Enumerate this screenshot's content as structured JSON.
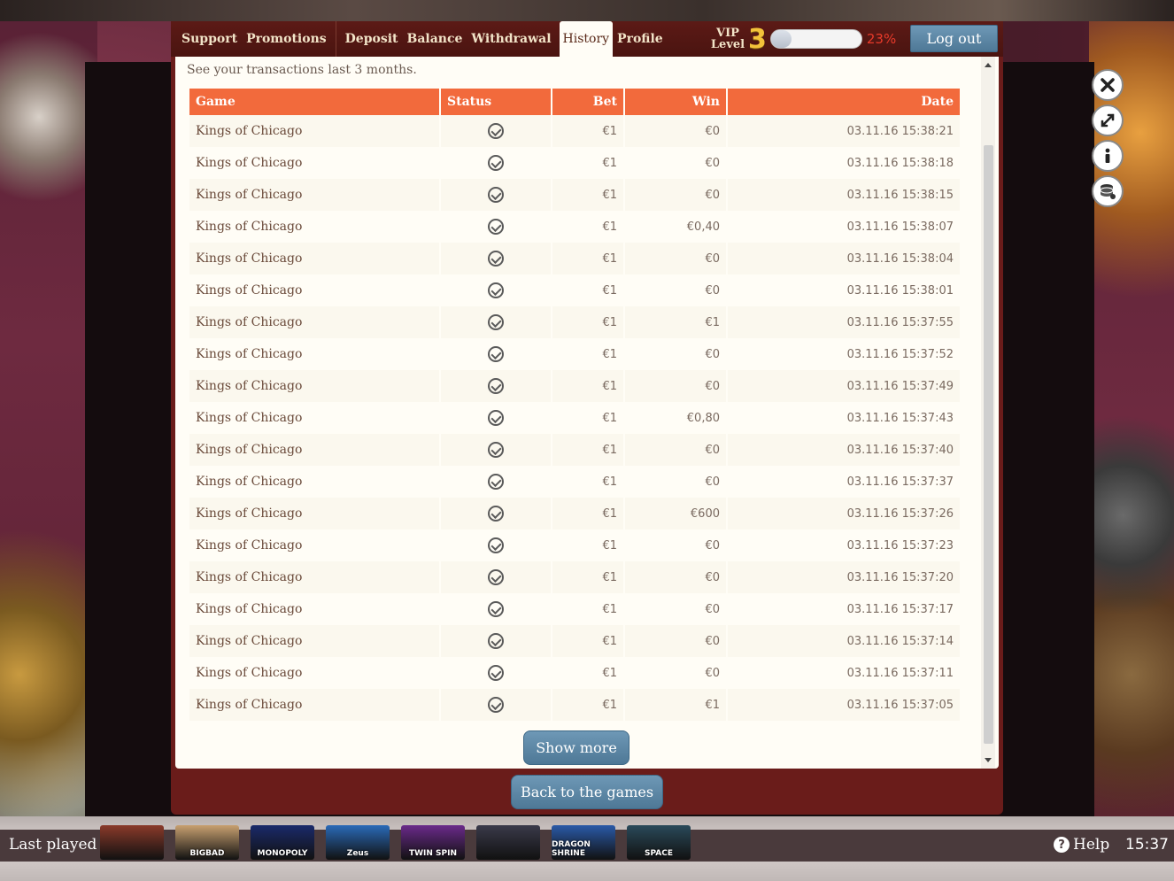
{
  "nav": {
    "support": "Support",
    "promotions": "Promotions",
    "deposit": "Deposit",
    "balance": "Balance",
    "withdrawal": "Withdrawal",
    "history": "History",
    "profile": "Profile"
  },
  "vip": {
    "label_line1": "VIP",
    "label_line2": "Level",
    "level": "3",
    "progress_fraction": 0.23,
    "percent_text": "23%"
  },
  "logout_label": "Log out",
  "intro_text": "See your transactions last 3 months.",
  "table": {
    "headers": {
      "game": "Game",
      "status": "Status",
      "bet": "Bet",
      "win": "Win",
      "date": "Date"
    },
    "rows": [
      {
        "game": "Kings of Chicago",
        "bet": "€1",
        "win": "€0",
        "date": "03.11.16 15:38:21"
      },
      {
        "game": "Kings of Chicago",
        "bet": "€1",
        "win": "€0",
        "date": "03.11.16 15:38:18"
      },
      {
        "game": "Kings of Chicago",
        "bet": "€1",
        "win": "€0",
        "date": "03.11.16 15:38:15"
      },
      {
        "game": "Kings of Chicago",
        "bet": "€1",
        "win": "€0,40",
        "date": "03.11.16 15:38:07"
      },
      {
        "game": "Kings of Chicago",
        "bet": "€1",
        "win": "€0",
        "date": "03.11.16 15:38:04"
      },
      {
        "game": "Kings of Chicago",
        "bet": "€1",
        "win": "€0",
        "date": "03.11.16 15:38:01"
      },
      {
        "game": "Kings of Chicago",
        "bet": "€1",
        "win": "€1",
        "date": "03.11.16 15:37:55"
      },
      {
        "game": "Kings of Chicago",
        "bet": "€1",
        "win": "€0",
        "date": "03.11.16 15:37:52"
      },
      {
        "game": "Kings of Chicago",
        "bet": "€1",
        "win": "€0",
        "date": "03.11.16 15:37:49"
      },
      {
        "game": "Kings of Chicago",
        "bet": "€1",
        "win": "€0,80",
        "date": "03.11.16 15:37:43"
      },
      {
        "game": "Kings of Chicago",
        "bet": "€1",
        "win": "€0",
        "date": "03.11.16 15:37:40"
      },
      {
        "game": "Kings of Chicago",
        "bet": "€1",
        "win": "€0",
        "date": "03.11.16 15:37:37"
      },
      {
        "game": "Kings of Chicago",
        "bet": "€1",
        "win": "€600",
        "date": "03.11.16 15:37:26"
      },
      {
        "game": "Kings of Chicago",
        "bet": "€1",
        "win": "€0",
        "date": "03.11.16 15:37:23"
      },
      {
        "game": "Kings of Chicago",
        "bet": "€1",
        "win": "€0",
        "date": "03.11.16 15:37:20"
      },
      {
        "game": "Kings of Chicago",
        "bet": "€1",
        "win": "€0",
        "date": "03.11.16 15:37:17"
      },
      {
        "game": "Kings of Chicago",
        "bet": "€1",
        "win": "€0",
        "date": "03.11.16 15:37:14"
      },
      {
        "game": "Kings of Chicago",
        "bet": "€1",
        "win": "€0",
        "date": "03.11.16 15:37:11"
      },
      {
        "game": "Kings of Chicago",
        "bet": "€1",
        "win": "€1",
        "date": "03.11.16 15:37:05"
      }
    ]
  },
  "show_more_label": "Show more",
  "back_label": "Back to the games",
  "side_icons": [
    "close-icon",
    "fullscreen-icon",
    "info-icon",
    "coins-icon"
  ],
  "bottom": {
    "last_played_label": "Last played",
    "thumbnails": [
      {
        "icon": "game-thumb-cowboy",
        "label": "",
        "color": "#8a3a2a"
      },
      {
        "icon": "game-thumb-bigbad",
        "label": "BIGBAD",
        "color": "#c8a070"
      },
      {
        "icon": "game-thumb-monopoly",
        "label": "MONOPOLY",
        "color": "#1a2a6a"
      },
      {
        "icon": "game-thumb-zeus",
        "label": "Zeus",
        "color": "#2a6ab8"
      },
      {
        "icon": "game-thumb-twinspin",
        "label": "TWIN SPIN",
        "color": "#6a2a8a"
      },
      {
        "icon": "game-thumb-warriors",
        "label": "",
        "color": "#3a3a4a"
      },
      {
        "icon": "game-thumb-dragon-shrine",
        "label": "DRAGON SHRINE",
        "color": "#2a5aa8"
      },
      {
        "icon": "game-thumb-space",
        "label": "SPACE",
        "color": "#2a4a5a"
      }
    ],
    "help_label": "Help",
    "time": "15:37"
  }
}
